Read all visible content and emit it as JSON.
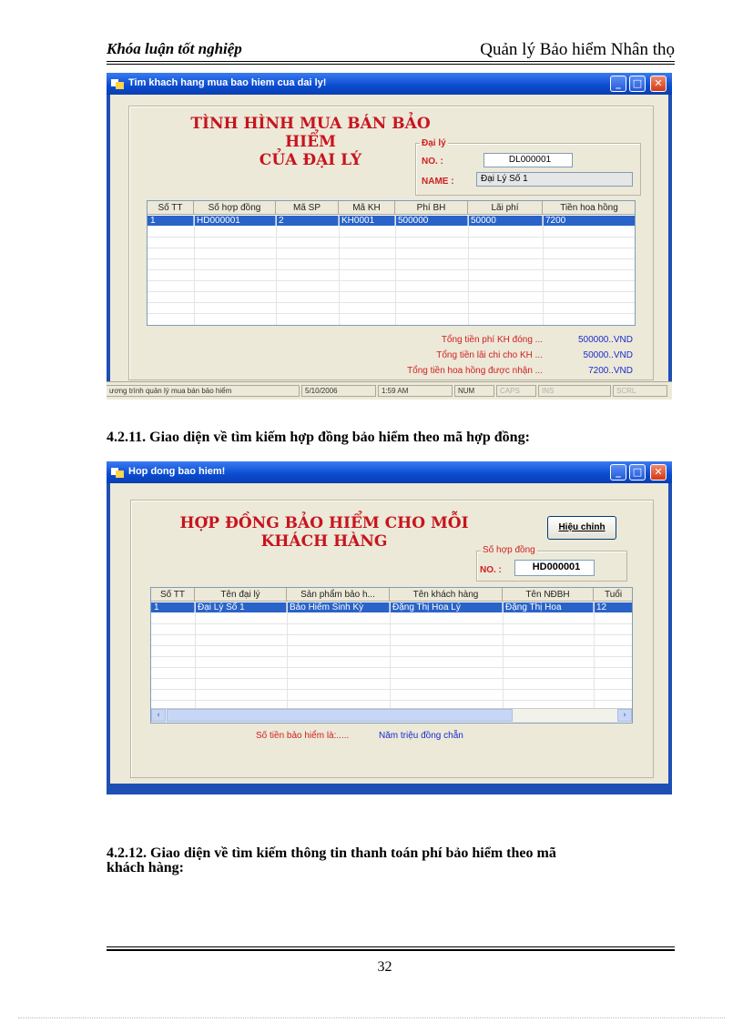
{
  "page_header": {
    "left": "Khóa luận tốt nghiệp",
    "right": "Quản lý Bảo hiểm Nhân thọ"
  },
  "window1": {
    "title": "Tim khach hang mua bao hiem cua dai ly!",
    "heading_line1": "TÌNH HÌNH MUA BÁN BẢO HIỂM",
    "heading_line2": "CỦA ĐẠI LÝ",
    "group_label": "Đại lý",
    "no_label": "NO. :",
    "no_value": "DL000001",
    "name_label": "NAME :",
    "name_value": "Đại Lý Số 1",
    "columns": [
      "Số TT",
      "Số hợp đồng",
      "Mã SP",
      "Mã KH",
      "Phí BH",
      "Lãi phí",
      "Tiền hoa hồng"
    ],
    "rows": [
      [
        "1",
        "HD000001",
        "2",
        "KH0001",
        "500000",
        "50000",
        "7200"
      ]
    ],
    "summary": [
      {
        "label": "Tổng tiền phí KH đóng ...",
        "value": "500000..VND"
      },
      {
        "label": "Tổng tiền lãi chi cho KH ...",
        "value": "50000..VND"
      },
      {
        "label": "Tổng tiền hoa hồng được nhận ...",
        "value": "7200..VND"
      }
    ],
    "status": {
      "message": "ương trình quản lý mua bán bảo hiểm",
      "date": "5/10/2006",
      "time": "1:59 AM",
      "num": "NUM",
      "caps": "CAPS",
      "ins": "INS",
      "scrl": "SCRL"
    }
  },
  "section_4_2_11": "4.2.11. Giao diện về tìm kiếm hợp đồng bảo hiểm theo mã hợp đồng:",
  "window2": {
    "title": "Hop dong bao hiem!",
    "heading_line1": "HỢP ĐỒNG BẢO HIỂM CHO MỖI",
    "heading_line2": "KHÁCH HÀNG",
    "edit_button": "Hiệu chỉnh",
    "group_label": "Số hợp đồng",
    "no_label": "NO. :",
    "no_value": "HD000001",
    "columns": [
      "Số TT",
      "Tên đại lý",
      "Sản phẩm bảo h...",
      "Tên khách hàng",
      "Tên NĐBH",
      "Tuổi"
    ],
    "rows": [
      [
        "1",
        "Đại Lý Số 1",
        "Bảo Hiểm Sinh Kỳ",
        "Đặng Thị Hoa Lý",
        "Đặng Thị Hoa",
        "12"
      ]
    ],
    "amount_label": "Số tiền bảo hiểm là:.....",
    "amount_value": "Năm triệu đồng chẵn"
  },
  "section_4_2_12_line1": "4.2.12. Giao diện về tìm kiếm thông tin thanh toán phí bảo hiểm theo mã",
  "section_4_2_12_line2": "khách hàng:",
  "page_number": "32",
  "colors": {
    "title_red": "#c8141e",
    "selection_blue": "#2a63c8",
    "xp_blue": "#0a4bd0"
  }
}
